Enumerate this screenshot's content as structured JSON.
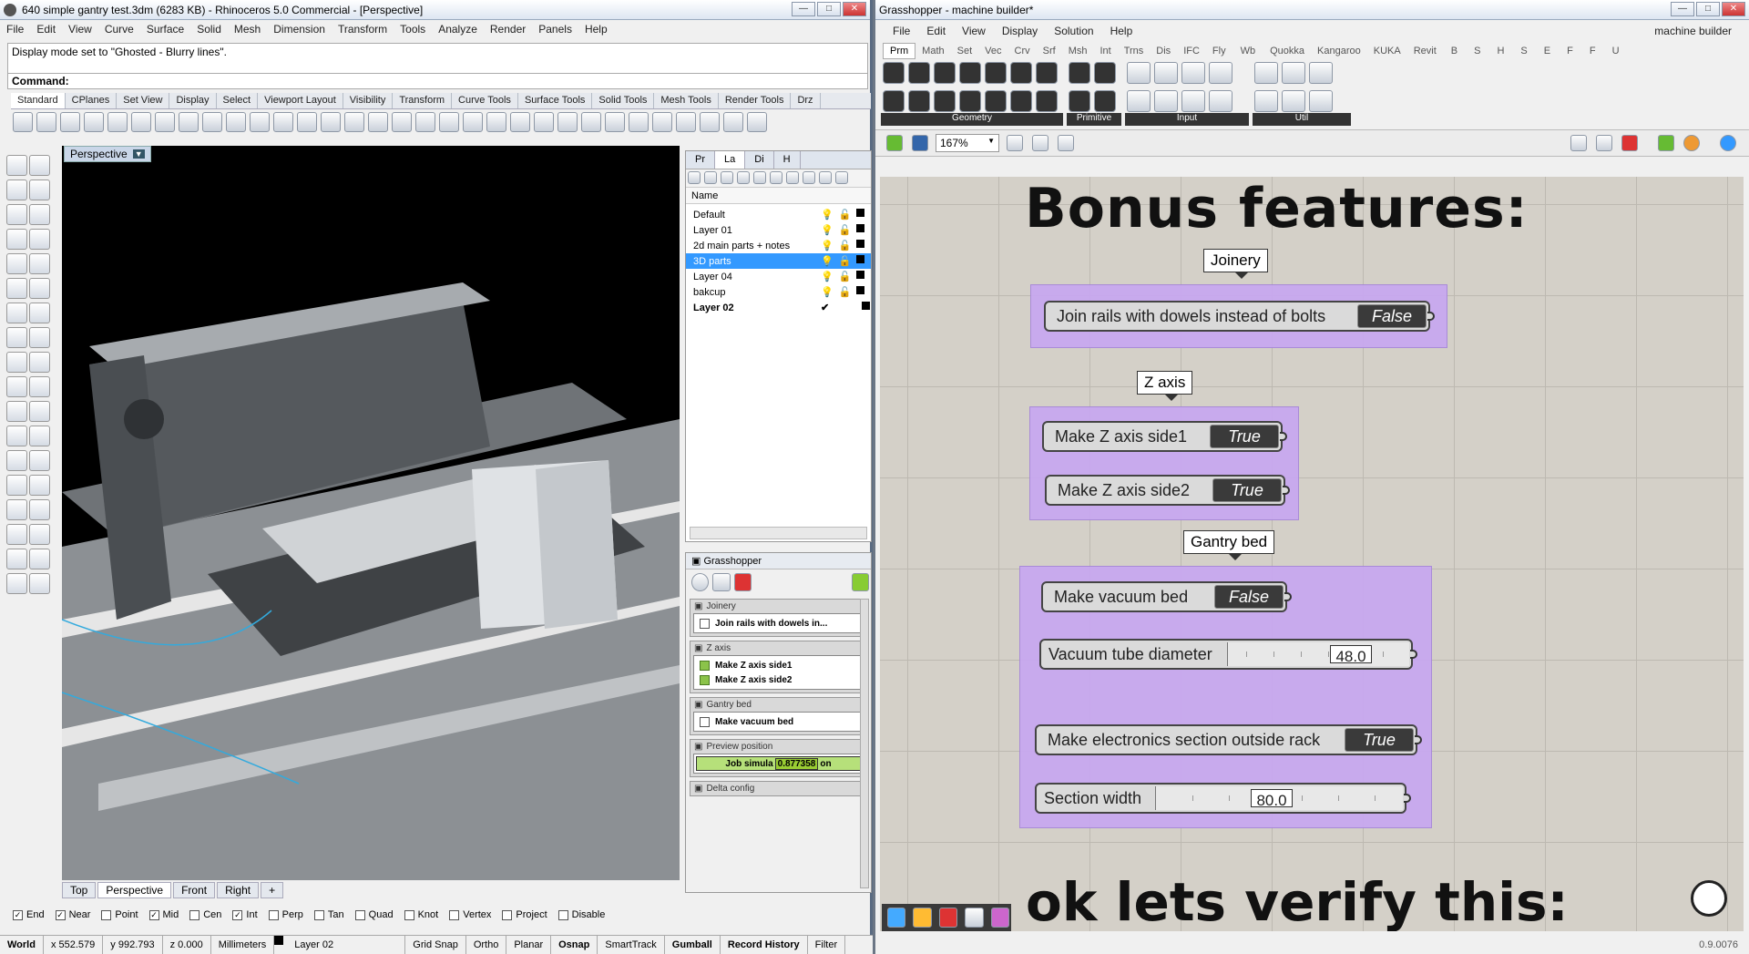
{
  "rhino": {
    "title": "640 simple gantry test.3dm (6283 KB) - Rhinoceros 5.0 Commercial - [Perspective]",
    "menu": [
      "File",
      "Edit",
      "View",
      "Curve",
      "Surface",
      "Solid",
      "Mesh",
      "Dimension",
      "Transform",
      "Tools",
      "Analyze",
      "Render",
      "Panels",
      "Help"
    ],
    "history": "Display mode set to \"Ghosted - Blurry lines\".",
    "command_label": "Command:",
    "toolbar_tabs": [
      "Standard",
      "CPlanes",
      "Set View",
      "Display",
      "Select",
      "Viewport Layout",
      "Visibility",
      "Transform",
      "Curve Tools",
      "Surface Tools",
      "Solid Tools",
      "Mesh Tools",
      "Render Tools",
      "Drz"
    ],
    "viewport_label": "Perspective",
    "viewport_tabs": [
      "Top",
      "Perspective",
      "Front",
      "Right",
      "+"
    ],
    "panel_tabs": [
      "Pr",
      "La",
      "Di",
      "H"
    ],
    "layers_header": "Name",
    "layers": [
      {
        "name": "Default",
        "color": "#000000"
      },
      {
        "name": "Layer 01",
        "color": "#000000"
      },
      {
        "name": "2d main parts + notes",
        "color": "#000000"
      },
      {
        "name": "3D parts",
        "color": "#000000"
      },
      {
        "name": "Layer 04",
        "color": "#000000"
      },
      {
        "name": "bakcup",
        "color": "#000000"
      },
      {
        "name": "Layer 02",
        "color": "#000000",
        "current": true,
        "mark": "✔"
      }
    ],
    "gh_panel_title": "Grasshopper",
    "gh_sections": [
      {
        "title": "Joinery",
        "items": [
          {
            "label": "Join rails with dowels in...",
            "checked": false
          }
        ]
      },
      {
        "title": "Z axis",
        "items": [
          {
            "label": "Make Z axis side1",
            "checked": true
          },
          {
            "label": "Make Z axis side2",
            "checked": true
          }
        ]
      },
      {
        "title": "Gantry bed",
        "items": [
          {
            "label": "Make vacuum bed",
            "checked": false
          }
        ]
      },
      {
        "title": "Preview position",
        "slider_label": "Job simula",
        "slider_value": "0.877358",
        "slider_suffix": "on"
      },
      {
        "title": "Delta config"
      }
    ],
    "osnaps": [
      {
        "label": "End",
        "checked": true
      },
      {
        "label": "Near",
        "checked": true
      },
      {
        "label": "Point",
        "checked": false
      },
      {
        "label": "Mid",
        "checked": true
      },
      {
        "label": "Cen",
        "checked": false
      },
      {
        "label": "Int",
        "checked": true
      },
      {
        "label": "Perp",
        "checked": false
      },
      {
        "label": "Tan",
        "checked": false
      },
      {
        "label": "Quad",
        "checked": false
      },
      {
        "label": "Knot",
        "checked": false
      },
      {
        "label": "Vertex",
        "checked": false
      },
      {
        "label": "Project",
        "checked": false
      },
      {
        "label": "Disable",
        "checked": false
      }
    ],
    "status": {
      "cplane": "World",
      "x": "x 552.579",
      "y": "y 992.793",
      "z": "z 0.000",
      "units": "Millimeters",
      "layer": "Layer 02",
      "toggles": [
        "Grid Snap",
        "Ortho",
        "Planar",
        "Osnap",
        "SmartTrack",
        "Gumball",
        "Record History",
        "Filter"
      ]
    }
  },
  "gh": {
    "title": "Grasshopper - machine builder*",
    "doc_name": "machine builder",
    "menu": [
      "File",
      "Edit",
      "View",
      "Display",
      "Solution",
      "Help"
    ],
    "tabs": [
      "Prm",
      "Math",
      "Set",
      "Vec",
      "Crv",
      "Srf",
      "Msh",
      "Int",
      "Trns",
      "Dis",
      "IFC",
      "Fly",
      "Wb",
      "Quokka",
      "Kangaroo",
      "KUKA",
      "Revit",
      "B",
      "S",
      "H",
      "S",
      "E",
      "F",
      "F",
      "U"
    ],
    "ribbon_groups": [
      "Geometry",
      "Primitive",
      "Input",
      "Util"
    ],
    "zoom": "167%",
    "heading1": "Bonus features:",
    "heading2": "ok lets verify this:",
    "version": "0.9.0076",
    "groups": {
      "joinery": {
        "label": "Joinery",
        "toggle_label": "Join rails with dowels instead of bolts",
        "value": "False"
      },
      "zaxis": {
        "label": "Z axis",
        "t1_label": "Make Z axis side1",
        "t1_value": "True",
        "t2_label": "Make Z axis side2",
        "t2_value": "True"
      },
      "bed": {
        "label": "Gantry bed",
        "vac_label": "Make vacuum bed",
        "vac_value": "False",
        "tube_label": "Vacuum tube diameter",
        "tube_value": "48.0",
        "elec_label": "Make electronics section outside rack",
        "elec_value": "True",
        "width_label": "Section width",
        "width_value": "80.0"
      }
    }
  }
}
